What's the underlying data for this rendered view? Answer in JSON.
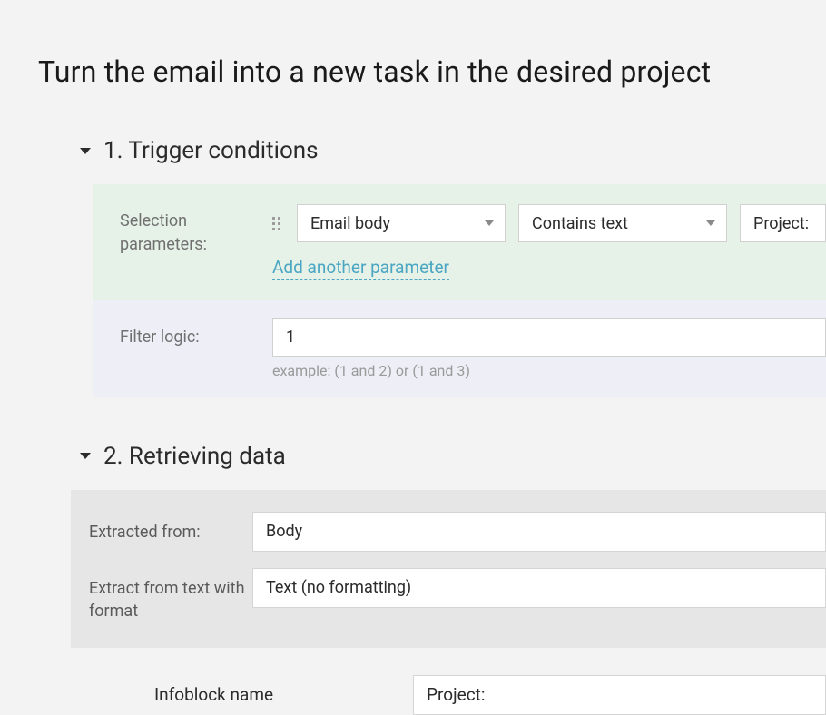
{
  "page_title": "Turn the email into a new task in the desired project",
  "section1": {
    "heading": "1. Trigger conditions",
    "selection_label": "Selection parameters:",
    "param_field": "Email body",
    "param_operator": "Contains text",
    "param_value": "Project:",
    "add_link": "Add another parameter",
    "filter_label": "Filter logic:",
    "filter_value": "1",
    "filter_hint": "example: (1 and 2) or (1 and 3)"
  },
  "section2": {
    "heading": "2. Retrieving data",
    "extracted_from_label": "Extracted from:",
    "extracted_from_value": "Body",
    "format_label": "Extract from text with format",
    "format_value": "Text (no formatting)",
    "infoblock_label": "Infoblock name",
    "infoblock_value": "Project:"
  }
}
